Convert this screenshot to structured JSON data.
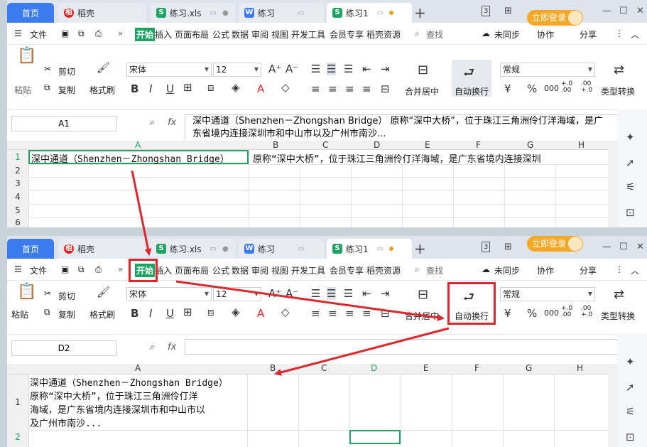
{
  "tabs": {
    "home": "首页",
    "daoke": "稻壳",
    "xls": "练习.xls",
    "doc": "练习",
    "active": "练习1",
    "plus": "+"
  },
  "badge": "3",
  "login": "立即登录",
  "menu": {
    "file": "文件",
    "start": "开始",
    "items": [
      "插入",
      "页面布局",
      "公式",
      "数据",
      "审阅",
      "视图",
      "开发工具",
      "会员专享",
      "稻壳资源"
    ],
    "search": "查找",
    "sync": "未同步",
    "collab": "协作",
    "share": "分享"
  },
  "ribbon": {
    "paste": "粘贴",
    "cut": "剪切",
    "copy": "复制",
    "painter": "格式刷",
    "font": "宋体",
    "size": "12",
    "merge": "合并居中",
    "wrap": "自动换行",
    "numfmt": "常规",
    "currency": "¥",
    "percent": "%",
    "thousands": "000",
    "inc": "+.0 .00",
    "dec": ".00 +.0",
    "typeconv": "类型转换"
  },
  "top": {
    "namebox": "A1",
    "formula": "深中通道（Shenzhen－Zhongshan Bridge） 原称“深中大桥”，位于珠江三角洲伶仃洋海域，是广东省境内连接深圳市和中山市以及广州市南沙...",
    "cols": [
      "A",
      "B",
      "C",
      "D",
      "E",
      "F",
      "G",
      "H"
    ],
    "rows": [
      "1",
      "2",
      "3",
      "4",
      "5",
      "6"
    ],
    "cellA1": "深中通道（Shenzhen－Zhongshan Bridge）",
    "overflow": "原称“深中大桥”，位于珠江三角洲伶仃洋海域，是广东省境内连接深圳"
  },
  "bottom": {
    "namebox": "D2",
    "cols": [
      "A",
      "B",
      "C",
      "D",
      "E",
      "F",
      "G",
      "H"
    ],
    "rows": [
      "1",
      "2"
    ],
    "wrapped": [
      "深中通道（Shenzhen－Zhongshan Bridge）",
      "原称“深中大桥”，位于珠江三角洲伶仃洋",
      "海域，是广东省境内连接深圳市和中山市以",
      "及广州市南沙..."
    ]
  },
  "colors": {
    "accent": "#1ea362",
    "home": "#3a7bf0",
    "login": "#f4a825",
    "annotation": "#e0262b"
  }
}
